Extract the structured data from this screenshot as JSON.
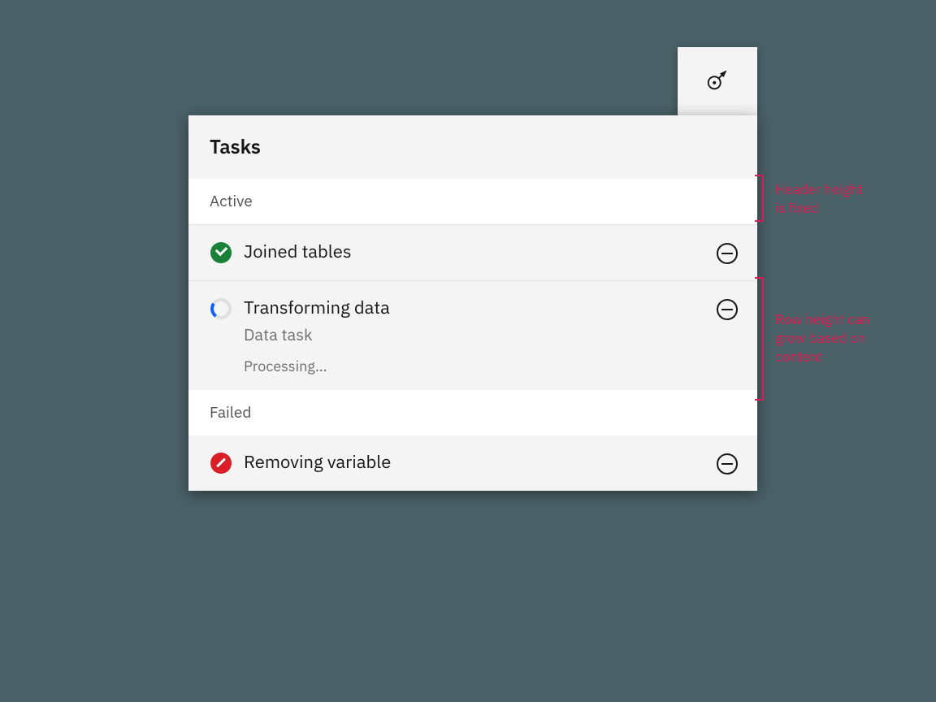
{
  "panel": {
    "title": "Tasks",
    "sections": [
      {
        "header": "Active",
        "rows": [
          {
            "icon": "success",
            "title": "Joined tables",
            "subtitle": null,
            "status": null
          },
          {
            "icon": "in-progress",
            "title": "Transforming data",
            "subtitle": "Data task",
            "status": "Processing…"
          }
        ]
      },
      {
        "header": "Failed",
        "rows": [
          {
            "icon": "error",
            "title": "Removing variable",
            "subtitle": null,
            "status": null
          }
        ]
      }
    ]
  },
  "annotations": {
    "header_note": "Header height\nis fixed",
    "row_note": "Row height can\ngrow based on\ncontent"
  },
  "colors": {
    "background_teal": "#4a6168",
    "panel_grey": "#f4f4f4",
    "section_white": "#ffffff",
    "text_primary": "#161616",
    "text_secondary": "#6f6f6f",
    "success": "#198038",
    "progress_blue": "#0f62fe",
    "error": "#da1e28",
    "annotation_pink": "#da1e54"
  }
}
